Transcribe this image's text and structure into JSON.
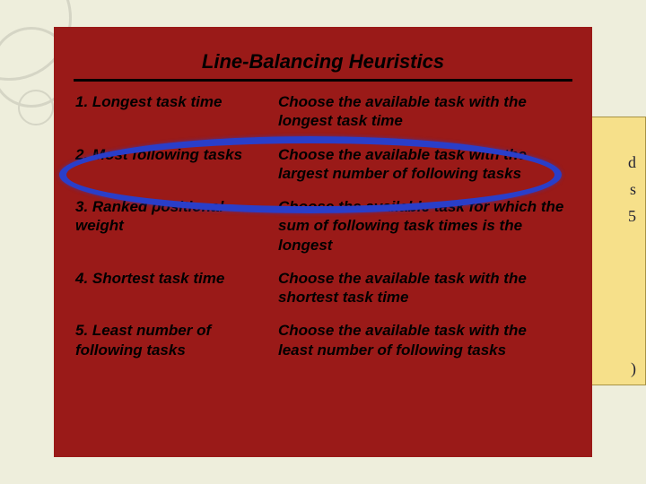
{
  "title": "Line-Balancing Heuristics",
  "heuristics": [
    {
      "name": "1. Longest task time",
      "desc": "Choose the available task with the longest task time"
    },
    {
      "name": "2. Most following tasks",
      "desc": "Choose the available task with the largest number of following tasks"
    },
    {
      "name": "3. Ranked positional weight",
      "desc": "Choose the available task for which the sum of following task times is the longest"
    },
    {
      "name": "4. Shortest task time",
      "desc": "Choose the available task with the shortest task time"
    },
    {
      "name": "5. Least number of following tasks",
      "desc": "Choose the available task with the least number of following tasks"
    }
  ],
  "behind_fragments": {
    "a": "d",
    "b": "s",
    "c": "5",
    "d": ")"
  },
  "highlighted_index": 1
}
